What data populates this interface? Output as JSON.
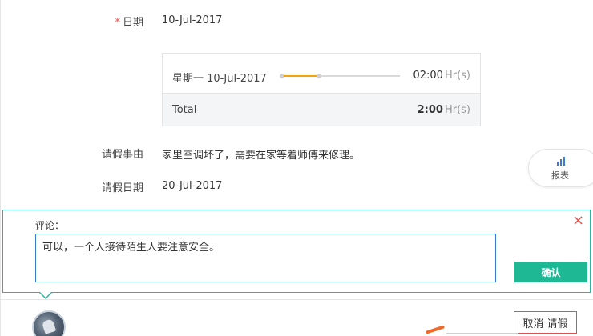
{
  "form": {
    "date": {
      "label": "日期",
      "value": "10-Jul-2017"
    },
    "hours": {
      "day_label": "星期一 10-Jul-2017",
      "day_hours": "02:00",
      "unit": "Hr(s)",
      "total_label": "Total",
      "total_hours": "2:00",
      "slider_fraction": 0.25
    },
    "reason": {
      "label": "请假事由",
      "value": "家里空调坏了，需要在家等着师傅来修理。"
    },
    "leave_date": {
      "label": "请假日期",
      "value": "20-Jul-2017"
    }
  },
  "report": {
    "label": "报表",
    "icon": "bar-chart-icon"
  },
  "comment": {
    "label": "评论：",
    "value": "可以，一个人接待陌生人要注意安全。",
    "confirm_label": "确认",
    "close_icon": "×"
  },
  "actions": {
    "cancel_label": "取消 请假"
  },
  "colors": {
    "accent": "#1fb894",
    "danger": "#d9534f",
    "slider": "#f0a30a",
    "input_border": "#3a7bd5"
  }
}
